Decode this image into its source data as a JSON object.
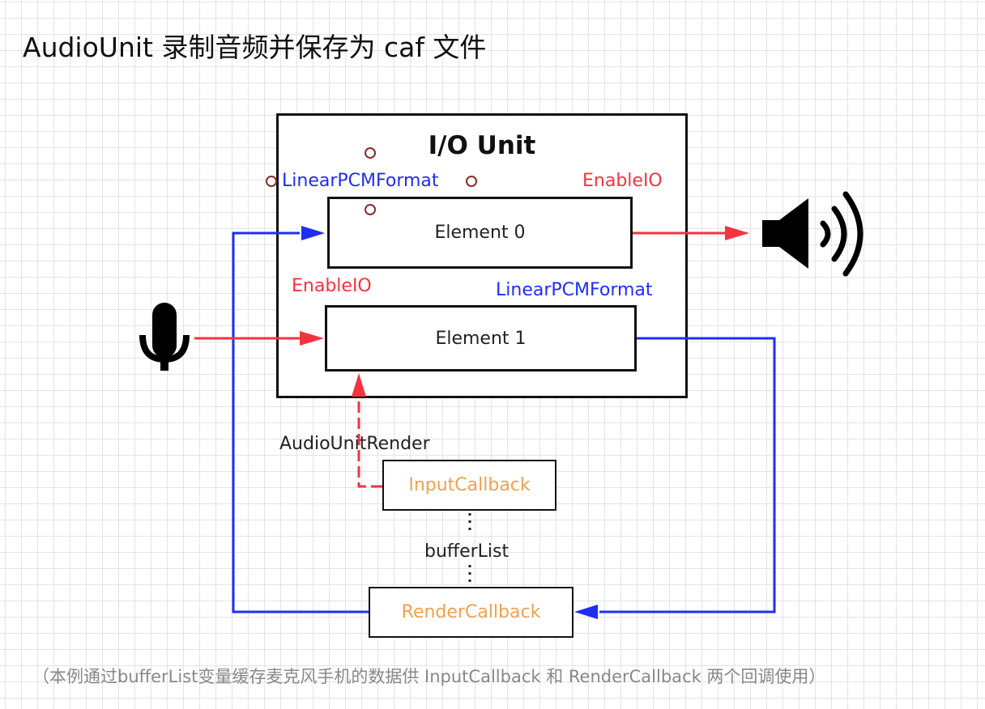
{
  "title": "AudioUnit 录制音频并保存为 caf 文件",
  "io_unit": {
    "label": "I/O Unit",
    "element0": "Element 0",
    "element1": "Element 1"
  },
  "labels": {
    "linear_pcm_top": "LinearPCMFormat",
    "enable_io_top": "EnableIO",
    "enable_io_bottom": "EnableIO",
    "linear_pcm_bottom": "LinearPCMFormat",
    "audio_unit_render": "AudioUnitRender",
    "buffer_list": "bufferList"
  },
  "callbacks": {
    "input": "InputCallback",
    "render": "RenderCallback"
  },
  "footnote": "（本例通过bufferList变量缓存麦克风手机的数据供 InputCallback 和 RenderCallback 两个回调使用）",
  "colors": {
    "blue": "#1f2ef5",
    "red": "#f5333f",
    "orange": "#f0a050"
  },
  "icons": [
    "microphone-icon",
    "speaker-icon"
  ]
}
